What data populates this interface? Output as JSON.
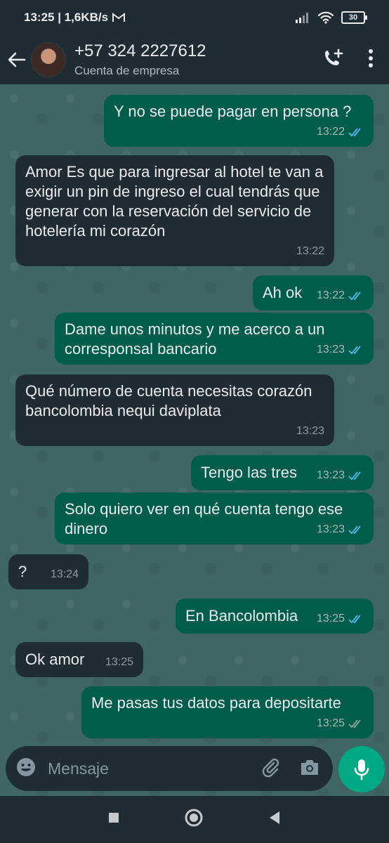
{
  "status_bar": {
    "time_speed": "13:25 | 1,6KB/s",
    "battery": "30",
    "icons": [
      "gmail-icon",
      "signal-icon",
      "wifi-icon",
      "battery-icon"
    ]
  },
  "header": {
    "contact_name": "+57 324 2227612",
    "subtitle": "Cuenta de empresa",
    "icons": [
      "back-arrow-icon",
      "add-call-icon",
      "more-vert-icon"
    ]
  },
  "messages": [
    {
      "dir": "out",
      "text": "Y no se puede pagar en persona ?",
      "time": "13:22",
      "read": true
    },
    {
      "dir": "in",
      "text": "Amor Es que para ingresar al hotel te van a exigir un pin de ingreso el cual tendrás que generar con la reservación del servicio de hotelería mi corazón",
      "time": "13:22"
    },
    {
      "dir": "out",
      "text": "Ah ok",
      "time": "13:22",
      "read": true
    },
    {
      "dir": "out",
      "text": "Dame unos minutos y me acerco a un corresponsal bancario",
      "time": "13:23",
      "read": true
    },
    {
      "dir": "in",
      "text": "Qué número de cuenta necesitas corazón bancolombia nequi daviplata",
      "time": "13:23"
    },
    {
      "dir": "out",
      "text": "Tengo las tres",
      "time": "13:23",
      "read": true
    },
    {
      "dir": "out",
      "text": "Solo quiero ver en qué cuenta tengo ese dinero",
      "time": "13:23",
      "read": true
    },
    {
      "dir": "in",
      "text": "?",
      "time": "13:24"
    },
    {
      "dir": "out",
      "text": "En Bancolombia",
      "time": "13:25",
      "read": true
    },
    {
      "dir": "in",
      "text": "Ok amor",
      "time": "13:25"
    },
    {
      "dir": "out",
      "text": "Me pasas tus datos para depositarte",
      "time": "13:25",
      "read": true
    }
  ],
  "input": {
    "placeholder": "Mensaje"
  },
  "colors": {
    "outgoing_bubble": "#005c4b",
    "incoming_bubble": "#1f2c33",
    "read_ticks": "#53bdeb",
    "accent": "#00a884"
  }
}
